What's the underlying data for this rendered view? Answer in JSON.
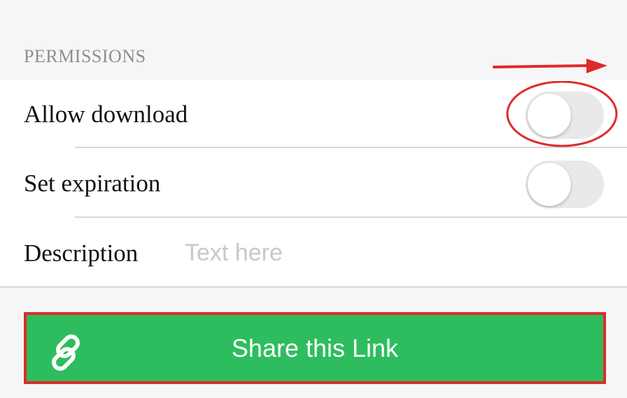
{
  "permissions": {
    "section_title": "PERMISSIONS",
    "allow_download": {
      "label": "Allow download",
      "enabled": false
    },
    "set_expiration": {
      "label": "Set expiration",
      "enabled": false
    },
    "description": {
      "label": "Description",
      "placeholder": "Text here",
      "value": ""
    }
  },
  "share_button": {
    "label": "Share this Link",
    "icon": "link-icon"
  },
  "annotations": {
    "highlight_color": "#e02a2a"
  },
  "colors": {
    "accent_green": "#2dbd5e",
    "background": "#f6f6f6",
    "toggle_off": "#e9e9ea"
  }
}
